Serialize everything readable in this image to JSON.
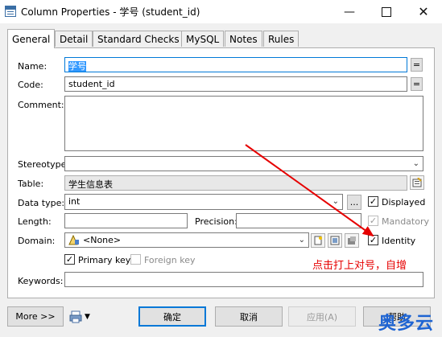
{
  "window": {
    "title": "Column Properties - 学号 (student_id)"
  },
  "tabs": [
    {
      "label": "General"
    },
    {
      "label": "Detail"
    },
    {
      "label": "Standard Checks"
    },
    {
      "label": "MySQL"
    },
    {
      "label": "Notes"
    },
    {
      "label": "Rules"
    }
  ],
  "form": {
    "name_label": "Name:",
    "name_value": "学号",
    "eq_label": "=",
    "code_label": "Code:",
    "code_value": "student_id",
    "comment_label": "Comment:",
    "comment_value": "",
    "stereotype_label": "Stereotype:",
    "stereotype_value": "",
    "table_label": "Table:",
    "table_value": "学生信息表",
    "datatype_label": "Data type:",
    "datatype_value": "int",
    "ellipsis": "...",
    "length_label": "Length:",
    "length_value": "",
    "precision_label": "Precision:",
    "precision_value": "",
    "domain_label": "Domain:",
    "domain_value": "<None>",
    "displayed_label": "Displayed",
    "displayed_checked": true,
    "mandatory_label": "Mandatory",
    "mandatory_checked": true,
    "identity_label": "Identity",
    "identity_checked": true,
    "primary_key_label": "Primary key",
    "primary_key_checked": true,
    "foreign_key_label": "Foreign key",
    "foreign_key_checked": false,
    "keywords_label": "Keywords:",
    "keywords_value": ""
  },
  "annotation": {
    "text": "点击打上对号，自增",
    "color": "#e60000"
  },
  "buttons": {
    "more": "More >>",
    "ok": "确定",
    "cancel": "取消",
    "apply": "应用(A)",
    "help": "帮助"
  },
  "watermark": {
    "text": "奥多云"
  }
}
